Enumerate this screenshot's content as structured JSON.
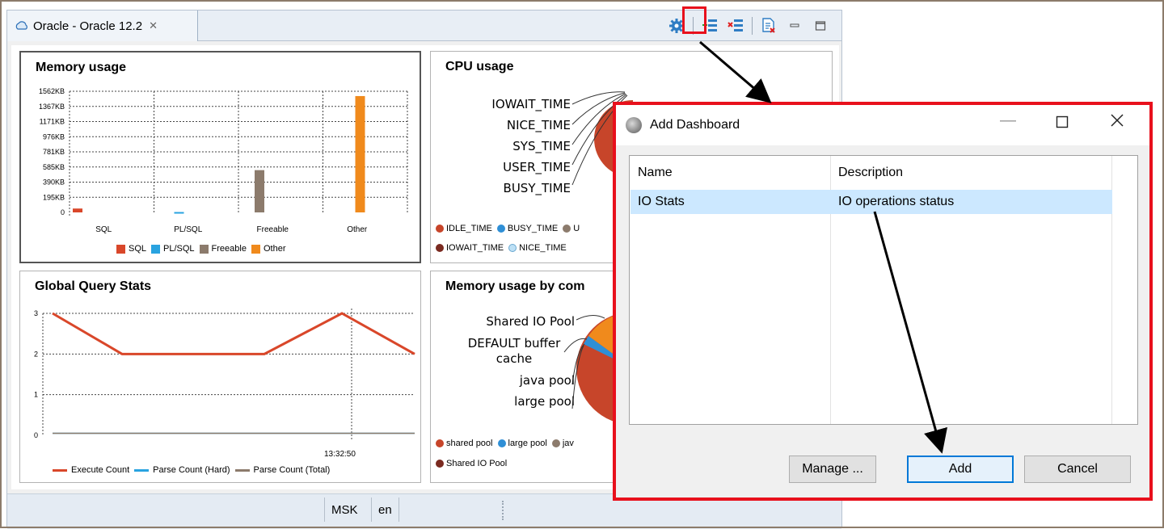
{
  "editor": {
    "tab_label": "Oracle - Oracle 12.2",
    "tab_close": "✕"
  },
  "memory_usage": {
    "title": "Memory usage",
    "y_ticks": [
      "1562KB",
      "1367KB",
      "1171KB",
      "976KB",
      "781KB",
      "585KB",
      "390KB",
      "195KB",
      "0"
    ],
    "x_labels": [
      "SQL",
      "PL/SQL",
      "Freeable",
      "Other"
    ],
    "legend": [
      "SQL",
      "PL/SQL",
      "Freeable",
      "Other"
    ],
    "colors": [
      "#d9472a",
      "#29a3e0",
      "#8c7b6c",
      "#f08a1c"
    ]
  },
  "cpu_usage": {
    "title": "CPU usage",
    "pie_labels": [
      "IOWAIT_TIME",
      "NICE_TIME",
      "SYS_TIME",
      "USER_TIME",
      "BUSY_TIME"
    ],
    "legend_row1": [
      "IDLE_TIME",
      "BUSY_TIME",
      "U"
    ],
    "legend_row2": [
      "IOWAIT_TIME",
      "NICE_TIME"
    ]
  },
  "global_query_stats": {
    "title": "Global Query Stats",
    "y_ticks": [
      "3",
      "2",
      "1",
      "0"
    ],
    "x_label": "13:32:50",
    "legend": [
      "Execute Count",
      "Parse Count (Hard)",
      "Parse Count (Total)"
    ],
    "colors": [
      "#d9472a",
      "#29a3e0",
      "#8c7b6c"
    ]
  },
  "memory_by_component": {
    "title": "Memory usage by com",
    "pie_labels": [
      "Shared IO Pool",
      "DEFAULT buffer cache",
      "java pool",
      "large pool"
    ],
    "legend_row1": [
      "shared pool",
      "large pool",
      "jav"
    ],
    "legend_row2": [
      "Shared IO Pool"
    ]
  },
  "status": {
    "timezone": "MSK",
    "locale": "en"
  },
  "dialog": {
    "title": "Add Dashboard",
    "columns": [
      "Name",
      "Description"
    ],
    "rows": [
      {
        "name": "IO Stats",
        "description": "IO operations status"
      }
    ],
    "buttons": {
      "manage": "Manage ...",
      "add": "Add",
      "cancel": "Cancel"
    }
  },
  "chart_data": [
    {
      "type": "bar",
      "title": "Memory usage",
      "categories": [
        "SQL",
        "PL/SQL",
        "Freeable",
        "Other"
      ],
      "values": [
        50,
        5,
        545,
        1500
      ],
      "ylabel": "",
      "ylim": [
        0,
        1562
      ]
    },
    {
      "type": "line",
      "title": "Global Query Stats",
      "series": [
        {
          "name": "Execute Count",
          "values": [
            3,
            2,
            2,
            2,
            3,
            2
          ]
        },
        {
          "name": "Parse Count (Hard)",
          "values": [
            0.05,
            0.05,
            0.05,
            0.05,
            0.05,
            0.05
          ]
        },
        {
          "name": "Parse Count (Total)",
          "values": [
            0.05,
            0.05,
            0.05,
            0.05,
            0.05,
            0.05
          ]
        }
      ],
      "ylim": [
        0,
        3
      ]
    }
  ]
}
